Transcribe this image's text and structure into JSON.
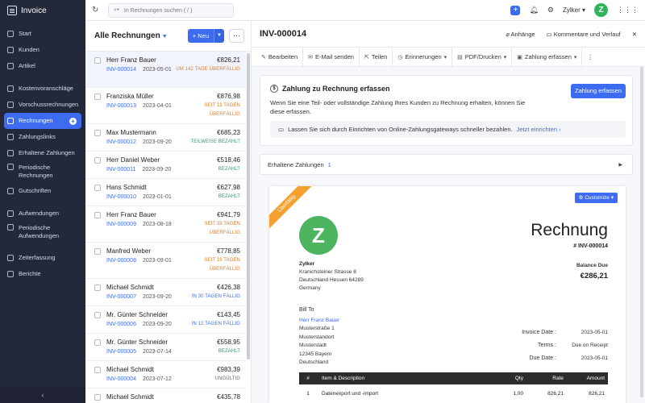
{
  "app": {
    "name": "Invoice"
  },
  "sidebar": {
    "items": [
      {
        "label": "Start"
      },
      {
        "label": "Kunden"
      },
      {
        "label": "Artikel"
      },
      {
        "label": "Kostenvoranschläge"
      },
      {
        "label": "Vorschussrechnungen"
      },
      {
        "label": "Rechnungen"
      },
      {
        "label": "Zahlungslinks"
      },
      {
        "label": "Erhaltene Zahlungen"
      },
      {
        "label": "Periodische Rechnungen"
      },
      {
        "label": "Gutschriften"
      },
      {
        "label": "Aufwendungen"
      },
      {
        "label": "Periodische Aufwendungen"
      },
      {
        "label": "Zeiterfassung"
      },
      {
        "label": "Berichte"
      }
    ],
    "collapse_icon": "chevron-left-icon"
  },
  "topbar": {
    "search_placeholder": "In Rechnungen suchen ( / )",
    "org_name": "Zylker",
    "avatar_letter": "Z"
  },
  "list": {
    "title": "Alle Rechnungen",
    "new_label": "Neu",
    "rows": [
      {
        "name": "Herr Franz Bauer",
        "amount": "€826,21",
        "number": "INV-000014",
        "date": "2023-05-01",
        "status": "UM 142 TAGE ÜBERFÄLLIG",
        "kind": "over"
      },
      {
        "name": "Franziska Müller",
        "amount": "€876,98",
        "number": "INV-000013",
        "date": "2023-04-01",
        "status": "SEIT 13 TAGEN ÜBERFÄLLIG",
        "kind": "over"
      },
      {
        "name": "Max Mustermann",
        "amount": "€685,23",
        "number": "INV-000012",
        "date": "2023-09-20",
        "status": "TEILWEISE BEZAHLT",
        "kind": "partial"
      },
      {
        "name": "Herr Daniel Weber",
        "amount": "€518,46",
        "number": "INV-000011",
        "date": "2023-09-20",
        "status": "BEZAHLT",
        "kind": "paid"
      },
      {
        "name": "Hans Schmidt",
        "amount": "€627,98",
        "number": "INV-000010",
        "date": "2023-01-01",
        "status": "BEZAHLT",
        "kind": "paid"
      },
      {
        "name": "Herr Franz Bauer",
        "amount": "€941,79",
        "number": "INV-000009",
        "date": "2023-08-18",
        "status": "SEIT 33 TAGEN ÜBERFÄLLIG",
        "kind": "over"
      },
      {
        "name": "Manfred Weber",
        "amount": "€778,85",
        "number": "INV-000008",
        "date": "2023-09-01",
        "status": "SEIT 19 TAGEN ÜBERFÄLLIG",
        "kind": "over"
      },
      {
        "name": "Michael Schmidt",
        "amount": "€426,38",
        "number": "INV-000007",
        "date": "2023-09-20",
        "status": "IN 30 TAGEN FÄLLIG",
        "kind": "due"
      },
      {
        "name": "Mr. Günter Schneider",
        "amount": "€143,45",
        "number": "INV-000006",
        "date": "2023-09-20",
        "status": "IN 12 TAGEN FÄLLIG",
        "kind": "due"
      },
      {
        "name": "Mr. Günter Schneider",
        "amount": "€558,95",
        "number": "INV-000005",
        "date": "2023-07-14",
        "status": "BEZAHLT",
        "kind": "paid"
      },
      {
        "name": "Michael Schmidt",
        "amount": "€983,39",
        "number": "INV-000004",
        "date": "2023-07-12",
        "status": "UNGÜLTIG",
        "kind": "void"
      },
      {
        "name": "Michael Schmidt",
        "amount": "€435,78",
        "number": "",
        "date": "",
        "status": "",
        "kind": "void"
      }
    ]
  },
  "detail": {
    "title": "INV-000014",
    "attachments": "Anhänge",
    "comments": "Kommentare und Verlauf",
    "toolbar": [
      "Bearbeiten",
      "E-Mail senden",
      "Teilen",
      "Erinnerungen",
      "PDF/Drucken",
      "Zahlung erfassen"
    ],
    "payment_card": {
      "title": "Zahlung zu Rechnung erfassen",
      "desc": "Wenn Sie eine Teil- oder vollständige Zahlung Ihres Kunden zu Rechnung erhalten, können Sie diese erfassen.",
      "button": "Zahlung erfassen",
      "gateway_text": "Lassen Sie sich durch Einrichten von Online-Zahlungsgateways schneller bezahlen.",
      "gateway_link": "Jetzt einrichten ›"
    },
    "received": {
      "label": "Erhaltene Zahlungen",
      "count": "1"
    },
    "paper": {
      "ribbon": "Überfällig",
      "customize": "Customize",
      "logo_letter": "Z",
      "doc_title": "Rechnung",
      "doc_number": "# INV-000014",
      "org_name": "Zylker",
      "org_lines": [
        "Kranichsteiner Strasse 8",
        "Deutschland Hessen 64289",
        "Germany"
      ],
      "balance_label": "Balance Due",
      "balance_value": "€286,21",
      "bill_to_label": "Bill To",
      "bill_to_name": "Herr Franz Bauer",
      "bill_to_lines": [
        "Musterstraße 1",
        "Musterstandort",
        "Musterstadt",
        "12345 Bayern",
        "Deutschland"
      ],
      "meta": [
        {
          "k": "Invoice Date :",
          "v": "2023-05-01"
        },
        {
          "k": "Terms :",
          "v": "Due on Receipt"
        },
        {
          "k": "Due Date :",
          "v": "2023-05-01"
        }
      ],
      "table_headers": {
        "num": "#",
        "desc": "Item & Description",
        "qty": "Qty",
        "rate": "Rate",
        "amount": "Amount"
      },
      "items": [
        {
          "num": "1",
          "desc": "Datenexport und -import",
          "qty": "1,00",
          "rate": "826,21",
          "amount": "826,21"
        }
      ]
    }
  },
  "colors": {
    "accent": "#3d6cf0",
    "sidebar": "#23283a",
    "overdue": "#e07b2a",
    "paid": "#2fa36b",
    "logo": "#4db560"
  }
}
